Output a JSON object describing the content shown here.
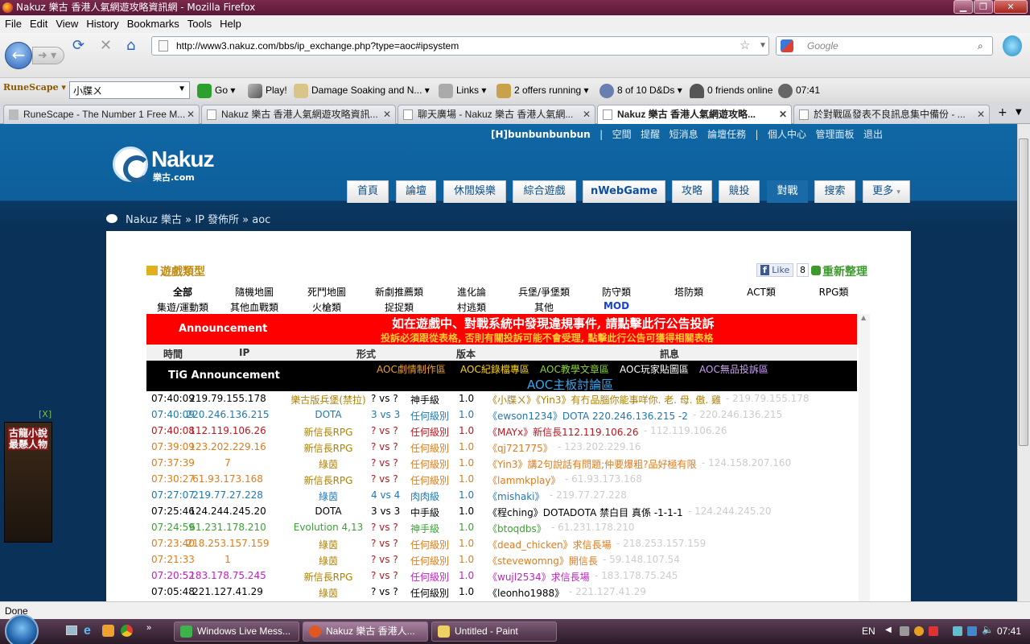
{
  "window": {
    "title": "Nakuz 樂古 香港人氣網遊攻略資訊網 - Mozilla Firefox"
  },
  "menu": [
    "File",
    "Edit",
    "View",
    "History",
    "Bookmarks",
    "Tools",
    "Help"
  ],
  "nav": {
    "url": "http://www3.nakuz.com/bbs/ip_exchange.php?type=aoc#ipsystem",
    "search_placeholder": "Google"
  },
  "toolbar": {
    "combo_value": "小牒ㄨ",
    "go": "Go",
    "play": "Play!",
    "damage": "Damage Soaking and N...",
    "links": "Links",
    "offers": "2 offers running",
    "dnds": "8 of 10 D&Ds",
    "friends": "0 friends online",
    "time": "07:41"
  },
  "tabs": [
    {
      "label": "RuneScape - The Number 1 Free M..."
    },
    {
      "label": "Nakuz 樂古 香港人氣網遊攻略資訊..."
    },
    {
      "label": "聊天廣場 - Nakuz 樂古 香港人氣網..."
    },
    {
      "label": "Nakuz 樂古 香港人氣網遊攻略..."
    },
    {
      "label": "於對戰區發表不良訊息集中備份 - ..."
    }
  ],
  "site": {
    "user": "[H]bunbunbunbun",
    "user_links": [
      "空間",
      "提醒",
      "短消息",
      "論壇任務",
      "個人中心",
      "管理面板",
      "退出"
    ],
    "logo_name": "Nakuz",
    "logo_sub": "樂古.com",
    "nav_tabs": [
      "首頁",
      "論壇",
      "休閒娛樂",
      "綜合遊戲",
      "nWebGame",
      "攻略",
      "競投",
      "對戰",
      "搜索",
      "更多"
    ],
    "breadcrumb": "Nakuz 樂古 » IP 發佈所 » aoc",
    "gametype_title": "遊戲類型",
    "like": "Like",
    "like_count": "8",
    "refresh": "重新整理",
    "categories_row1": [
      "全部",
      "隨機地圖",
      "死鬥地圖",
      "新劇推薦類",
      "進化論",
      "兵堡/爭堡類",
      "防守類",
      "塔防類",
      "ACT類",
      "RPG類"
    ],
    "categories_row2": [
      "集遊/運動類",
      "其他血戰類",
      "火槍類",
      "捉捉類",
      "村逃類",
      "其他",
      "MOD"
    ],
    "announcement_label": "Announcement",
    "announcement_line1": "如在遊戲中、對戰系統中發現違規事件, 請點擊此行公告投訴",
    "announcement_line2": "投訴必須跟從表格, 否則有關投訴可能不會受理, 點擊此行公告可獲得相關表格",
    "headers": [
      "時間",
      "IP",
      "形式",
      "版本",
      "訊息"
    ],
    "tig_label": "TiG Announcement",
    "tig_links": [
      "AOC劇情制作區",
      "AOC紀錄檔專區",
      "AOC教學文章區",
      "AOC玩家貼圖區",
      "AOC無品投訴區"
    ],
    "tig_big": "AOC主板討論區",
    "ad_close": "[X]"
  },
  "rows": [
    {
      "time": "07:40:09",
      "ip": "219.79.155.178",
      "mode": "樂古版兵堡(禁拉)",
      "vs": "? vs ?",
      "level": "神手級",
      "ver": "1.0",
      "msg": "《小牒ㄨ》《Yin3》有冇品腦你能事咩你. 老. 母. 傲. 雞",
      "ip2": "- 219.79.155.178",
      "color": "#000000",
      "color2": "#b08000"
    },
    {
      "time": "07:40:09",
      "ip": "220.246.136.215",
      "mode": "DOTA",
      "vs": "3 vs 3",
      "level": "任何級別",
      "ver": "1.0",
      "msg": "《ewson1234》DOTA 220.246.136.215 -2",
      "ip2": "- 220.246.136.215",
      "color": "#1f77b4",
      "color2": "#1f77b4"
    },
    {
      "time": "07:40:08",
      "ip": "112.119.106.26",
      "mode": "新信長RPG",
      "vs": "? vs ?",
      "level": "任何級別",
      "ver": "1.0",
      "msg": "《MAYx》新信長112.119.106.26",
      "ip2": "- 112.119.106.26",
      "color": "#c0141c",
      "color2": "#b08000"
    },
    {
      "time": "07:39:09",
      "ip": "123.202.229.16",
      "mode": "新信長RPG",
      "vs": "? vs ?",
      "level": "任何級別",
      "ver": "1.0",
      "msg": "《qj721775》",
      "ip2": "- 123.202.229.16",
      "color": "#e07b1a",
      "color2": "#b08000"
    },
    {
      "time": "07:37:39",
      "ip": "7",
      "mode": "綠茵",
      "vs": "? vs ?",
      "level": "任何級別",
      "ver": "1.0",
      "msg": "《Yin3》講2句說話有問題;仲要爆粗?品好極有限",
      "ip2": "- 124.158.207.160",
      "color": "#e07b1a",
      "color2": "#b08000"
    },
    {
      "time": "07:30:27",
      "ip": "61.93.173.168",
      "mode": "新信長RPG",
      "vs": "? vs ?",
      "level": "任何級別",
      "ver": "1.0",
      "msg": "《lammkplay》",
      "ip2": "- 61.93.173.168",
      "color": "#e07b1a",
      "color2": "#b08000"
    },
    {
      "time": "07:27:07",
      "ip": "219.77.27.228",
      "mode": "綠茵",
      "vs": "4 vs 4",
      "level": "肉肉級",
      "ver": "1.0",
      "msg": "《mishaki》",
      "ip2": "- 219.77.27.228",
      "color": "#1f77b4",
      "color2": "#1f77b4"
    },
    {
      "time": "07:25:46",
      "ip": "124.244.245.20",
      "mode": "DOTA",
      "vs": "3 vs 3",
      "level": "中手級",
      "ver": "1.0",
      "msg": "《程ching》DOTADOTA 禁白目 真係 -1-1-1",
      "ip2": "- 124.244.245.20",
      "color": "#000000",
      "color2": "#000000"
    },
    {
      "time": "07:24:59",
      "ip": "61.231.178.210",
      "mode": "Evolution 4,13",
      "vs": "? vs ?",
      "level": "神手級",
      "ver": "1.0",
      "msg": "《btoqdbs》",
      "ip2": "- 61.231.178.210",
      "color": "#3da035",
      "color2": "#3da035"
    },
    {
      "time": "07:23:40",
      "ip": "218.253.157.159",
      "mode": "綠茵",
      "vs": "? vs ?",
      "level": "任何級別",
      "ver": "1.0",
      "msg": "《dead_chicken》求信長場",
      "ip2": "- 218.253.157.159",
      "color": "#e07b1a",
      "color2": "#b08000"
    },
    {
      "time": "07:21:33",
      "ip": "1",
      "mode": "綠茵",
      "vs": "? vs ?",
      "level": "任何級別",
      "ver": "1.0",
      "msg": "《stevewomng》開信長",
      "ip2": "- 59.148.107.54",
      "color": "#e07b1a",
      "color2": "#b08000"
    },
    {
      "time": "07:20:52",
      "ip": "183.178.75.245",
      "mode": "新信長RPG",
      "vs": "? vs ?",
      "level": "任何級別",
      "ver": "1.0",
      "msg": "《wujl2534》求信長場",
      "ip2": "- 183.178.75.245",
      "color": "#c020c0",
      "color2": "#b08000"
    },
    {
      "time": "07:05:48",
      "ip": "221.127.41.29",
      "mode": "綠茵",
      "vs": "? vs ?",
      "level": "任何級別",
      "ver": "1.0",
      "msg": "《leonho1988》",
      "ip2": "- 221.127.41.29",
      "color": "#000000",
      "color2": "#b08000"
    }
  ],
  "status": "Done",
  "taskbar": {
    "items": [
      "Windows Live Mess...",
      "Nakuz 樂古 香港人...",
      "Untitled - Paint"
    ],
    "lang": "EN",
    "clock": "07:41"
  }
}
